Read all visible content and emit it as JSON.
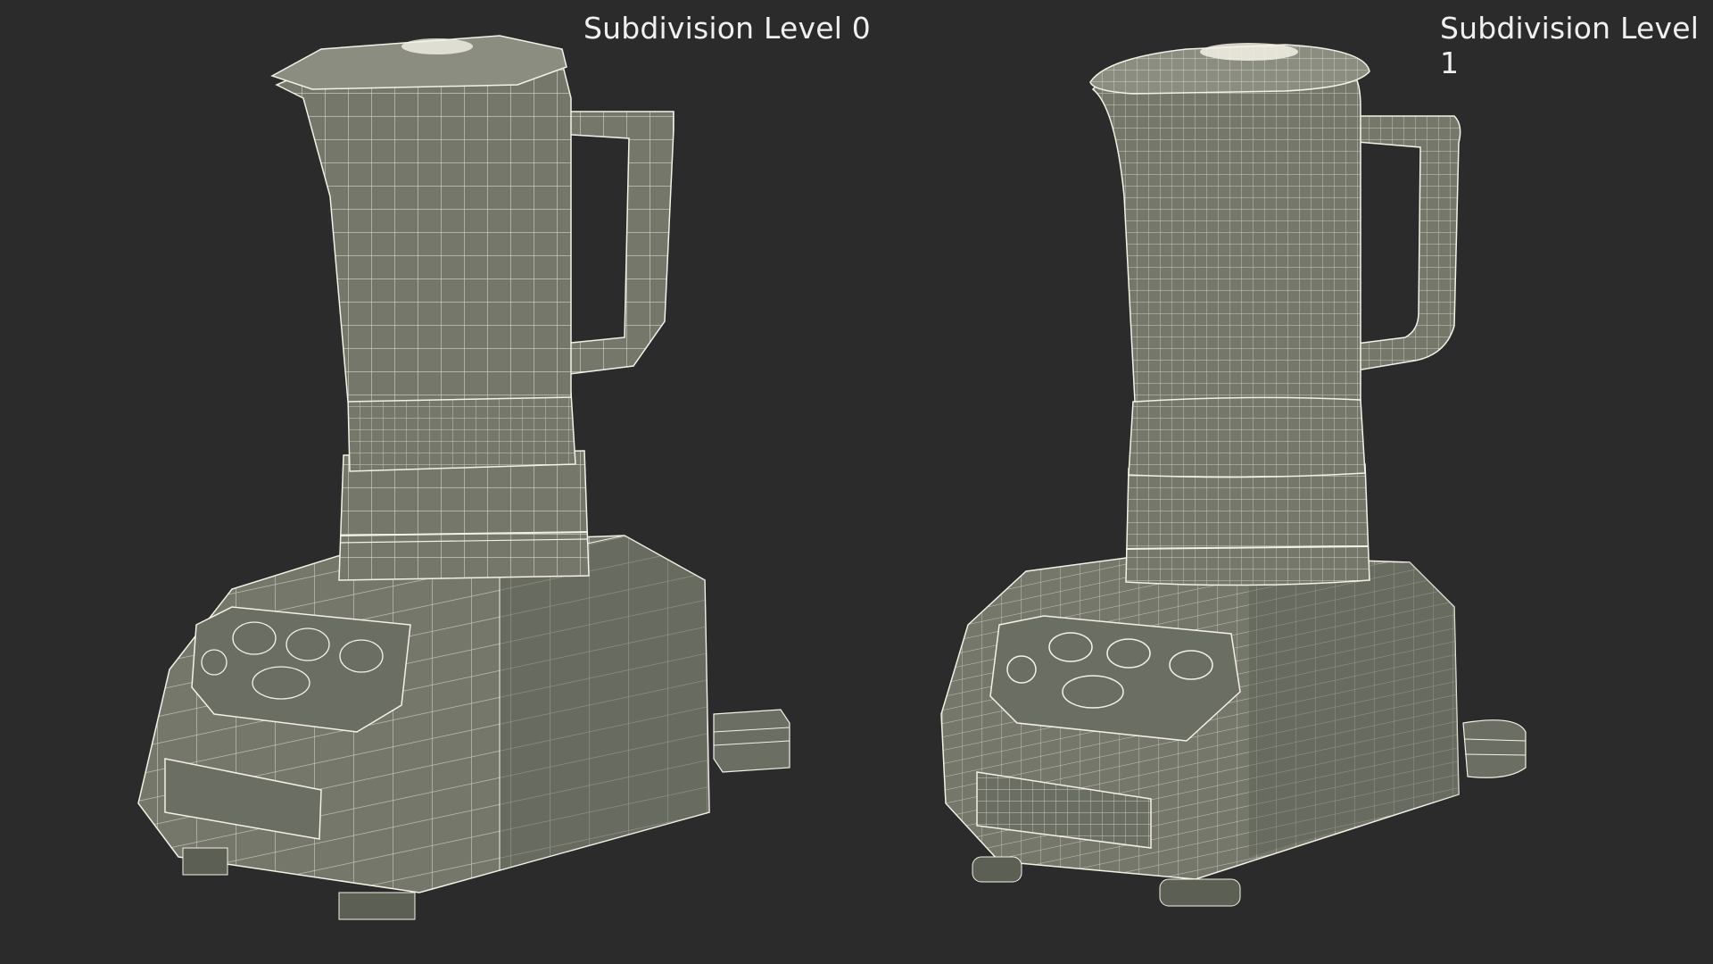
{
  "labels": {
    "left": "Subdivision Level 0",
    "right": "Subdivision Level 1"
  },
  "colors": {
    "background": "#2b2b2b",
    "surface": "#74776a",
    "surface_light": "#8a8d80",
    "surface_dark": "#5c5f54",
    "wire": "#f4f2e6",
    "text": "#f0f0f0"
  }
}
